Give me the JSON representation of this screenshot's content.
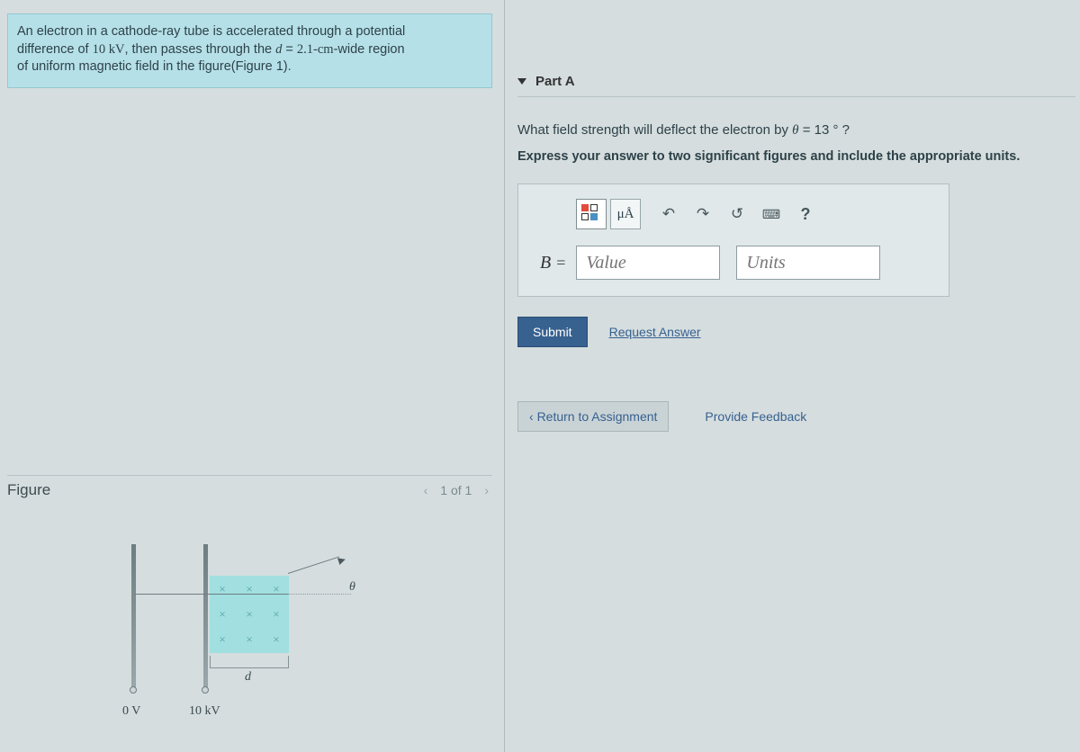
{
  "problem": {
    "line1a": "An electron in a cathode-ray tube is accelerated through a potential",
    "line2a": "difference of ",
    "voltage": "10 kV",
    "line2b": ", then passes through the ",
    "dvar": "d",
    "eq": " = ",
    "dwidth": "2.1-cm",
    "line2c": "-wide region",
    "line3": "of uniform magnetic field in the figure(Figure 1)."
  },
  "figure": {
    "title": "Figure",
    "pager": "1 of 1",
    "labels": {
      "v0": "0 V",
      "v1": "10 kV",
      "d": "d",
      "theta": "θ"
    }
  },
  "partA": {
    "label": "Part A",
    "question_a": "What field strength will deflect the electron by ",
    "theta_sym": "θ",
    "question_b": " = 13 ° ?",
    "instructions": "Express your answer to two significant figures and include the appropriate units.",
    "toolbar": {
      "mu": "μÅ",
      "undo": "↶",
      "redo": "↷",
      "reset": "↺",
      "keyboard": "⌨",
      "help": "?"
    },
    "answer": {
      "var": "B",
      "eq": "=",
      "value_placeholder": "Value",
      "units_placeholder": "Units"
    },
    "submit": "Submit",
    "request": "Request Answer"
  },
  "footer": {
    "return": "Return to Assignment",
    "feedback": "Provide Feedback"
  }
}
